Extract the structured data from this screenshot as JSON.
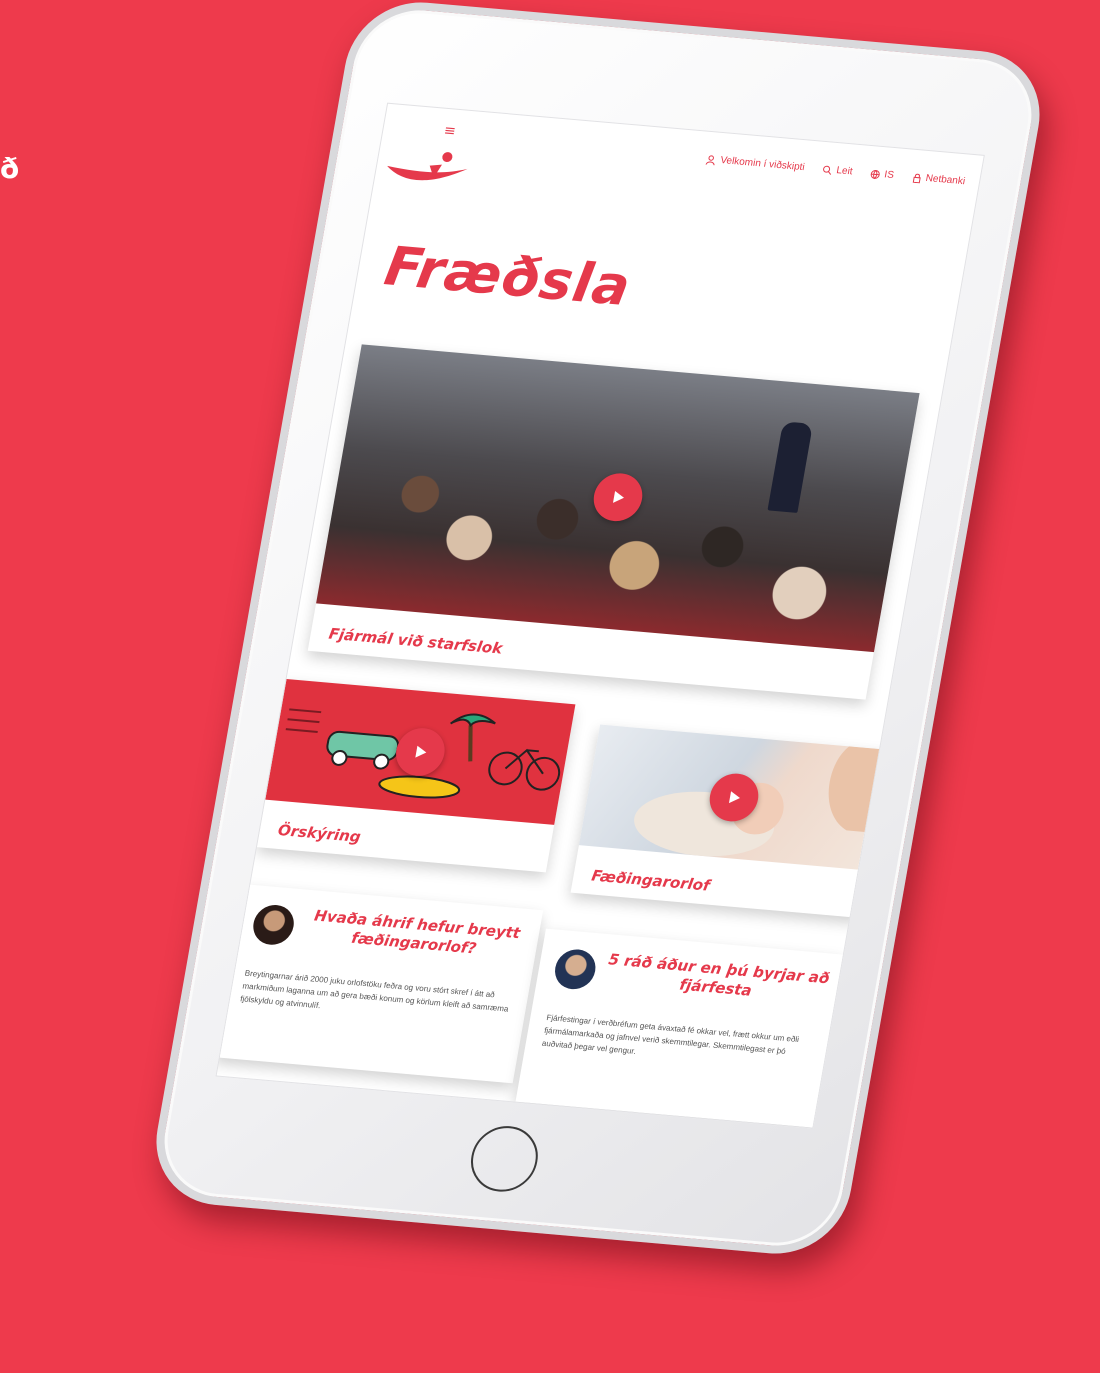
{
  "edge_text": "ð",
  "header": {
    "menu_icon": "hamburger-icon",
    "nav": [
      {
        "icon": "user-icon",
        "label": "Velkomin í viðskipti"
      },
      {
        "icon": "search-icon",
        "label": "Leit"
      },
      {
        "icon": "globe-icon",
        "label": "IS"
      },
      {
        "icon": "lock-icon",
        "label": "Netbanki"
      }
    ]
  },
  "page": {
    "title": "Fræðsla"
  },
  "cards": {
    "hero": {
      "label": "Fjármál við starfslok"
    },
    "explainer": {
      "label": "Örskýring"
    },
    "parental": {
      "label": "Fæðingarorlof"
    }
  },
  "articles": [
    {
      "title": "Hvaða áhrif hefur breytt fæðingarorlof?",
      "text": "Breytingarnar árið 2000 juku orlofstöku feðra og voru stórt skref í átt að markmiðum laganna um að gera bæði konum og körlum kleift að samræma fjölskyldu og atvinnulíf."
    },
    {
      "title": "5 ráð áður en þú byrjar að fjárfesta",
      "text": "Fjárfestingar í verðbréfum geta ávaxtað fé okkar vel, frætt okkur um eðli fjármálamarkaða og jafnvel verið skemmtilegar. Skemmtilegast er þó auðvitað þegar vel gengur."
    }
  ],
  "colors": {
    "brand": "#e5394b",
    "background": "#ee3a4c"
  }
}
